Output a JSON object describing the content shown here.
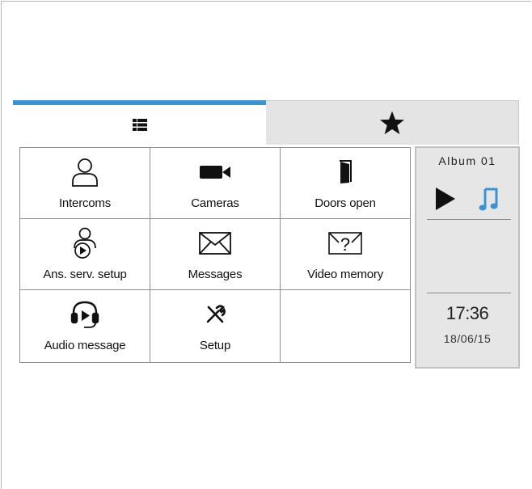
{
  "tabs": [
    {
      "icon": "grid-list-icon",
      "active": true
    },
    {
      "icon": "star-icon",
      "active": false
    }
  ],
  "colors": {
    "tab_accent": "#3d93d2",
    "music_icon": "#3d93d2",
    "panel_bg": "#e6e6e6"
  },
  "menu": {
    "intercoms": {
      "label": "Intercoms",
      "icon": "person-icon"
    },
    "cameras": {
      "label": "Cameras",
      "icon": "camera-icon"
    },
    "doors_open": {
      "label": "Doors open",
      "icon": "door-icon"
    },
    "ans_serv_setup": {
      "label": "Ans. serv. setup",
      "icon": "answering-service-icon"
    },
    "messages": {
      "label": "Messages",
      "icon": "envelope-icon"
    },
    "video_memory": {
      "label": "Video memory",
      "icon": "envelope-question-icon"
    },
    "audio_message": {
      "label": "Audio message",
      "icon": "headset-play-icon"
    },
    "setup": {
      "label": "Setup",
      "icon": "tools-icon"
    }
  },
  "player": {
    "album": "Album 01",
    "play_icon": "play-icon",
    "music_icon": "music-note-icon"
  },
  "clock": {
    "time": "17:36",
    "date": "18/06/15"
  }
}
